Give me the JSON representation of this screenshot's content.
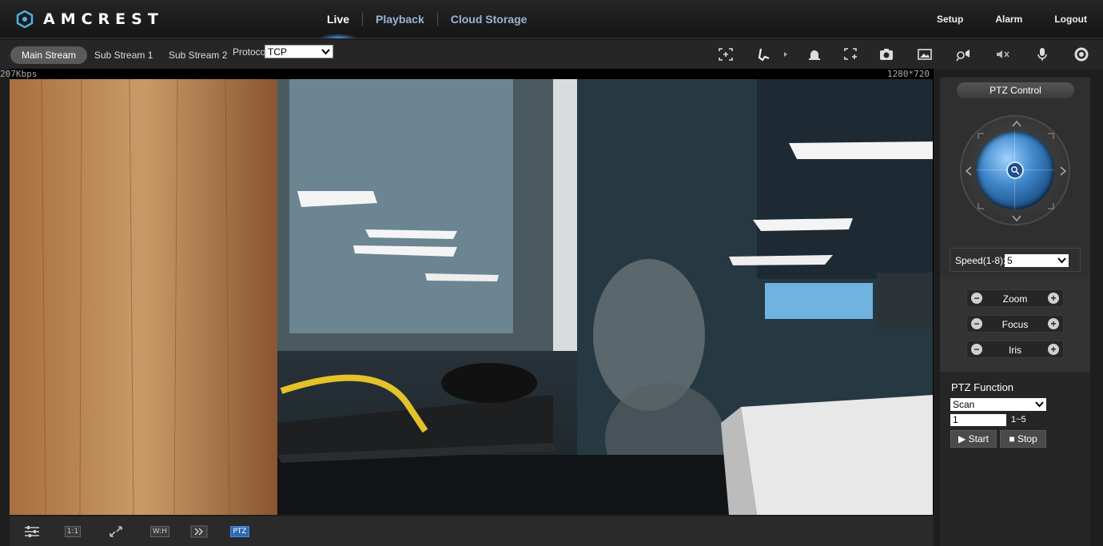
{
  "brand": {
    "name": "AMCREST"
  },
  "nav": {
    "tabs": [
      {
        "label": "Live",
        "active": true
      },
      {
        "label": "Playback",
        "active": false
      },
      {
        "label": "Cloud Storage",
        "active": false
      }
    ],
    "right": [
      "Setup",
      "Alarm",
      "Logout"
    ]
  },
  "stream": {
    "tabs": [
      {
        "label": "Main Stream",
        "active": true
      },
      {
        "label": "Sub Stream 1",
        "active": false
      },
      {
        "label": "Sub Stream 2",
        "active": false
      }
    ],
    "protocol_label": "Protocol",
    "protocol_value": "TCP"
  },
  "toolbar_icons": [
    "digital-zoom-icon",
    "draw-icon",
    "alarm-bell-icon",
    "region-zoom-icon",
    "snapshot-icon",
    "picture-icon",
    "talk-icon",
    "mute-icon",
    "microphone-icon",
    "settings-icon"
  ],
  "video": {
    "bitrate": "207Kbps",
    "resolution": "1280*720"
  },
  "bottombar": {
    "buttons": [
      {
        "icon": "image-adjust-icon",
        "text": ""
      },
      {
        "icon": "original-size-icon",
        "text": "1:1"
      },
      {
        "icon": "fullscreen-icon",
        "text": ""
      },
      {
        "icon": "aspect-ratio-icon",
        "text": "W:H"
      },
      {
        "icon": "fluency-icon",
        "text": ""
      },
      {
        "icon": "ptz-icon",
        "text": "PTZ"
      }
    ]
  },
  "ptz": {
    "title": "PTZ Control",
    "speed_label": "Speed(1-8):",
    "speed_value": "5",
    "lens": [
      {
        "label": "Zoom"
      },
      {
        "label": "Focus"
      },
      {
        "label": "Iris"
      }
    ],
    "minus": "−",
    "plus": "+",
    "function_title": "PTZ Function",
    "function_value": "Scan",
    "function_input": "1",
    "function_range": "1~5",
    "start_label": "Start",
    "stop_label": "Stop"
  },
  "colors": {
    "accent": "#2d6ab1",
    "nav_active": "#ffffff",
    "nav_inactive": "#9ab4d6",
    "panel_bg": "#2f2f2f"
  }
}
